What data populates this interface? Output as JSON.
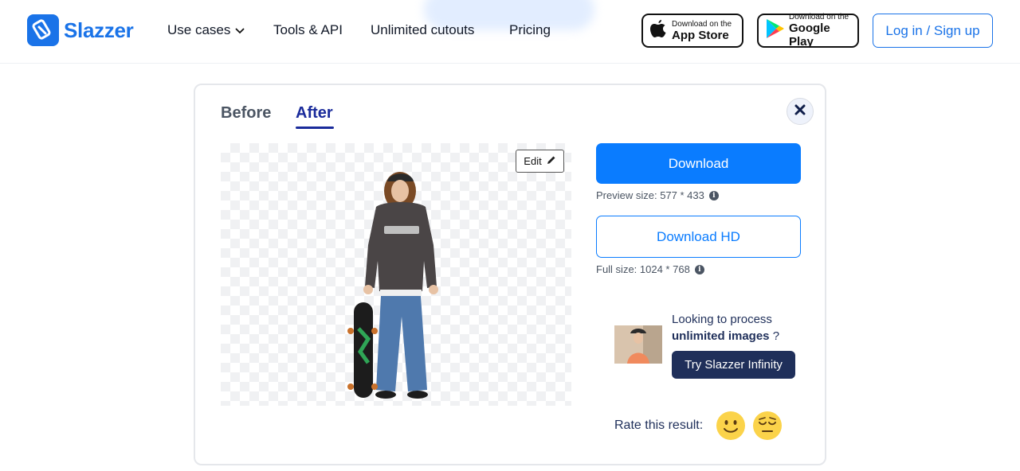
{
  "header": {
    "brand": "Slazzer",
    "nav": [
      {
        "label": "Use cases"
      },
      {
        "label": "Tools & API"
      },
      {
        "label": "Unlimited cutouts"
      },
      {
        "label": "Pricing"
      }
    ],
    "app_store": {
      "small": "Download on the",
      "big": "App Store",
      "icon": "apple-icon"
    },
    "google_play": {
      "small": "Download on the",
      "big": "Google Play",
      "icon": "google-play-icon"
    },
    "login_label": "Log in / Sign up",
    "accent": "#1a73e8"
  },
  "card": {
    "tabs": [
      {
        "label": "Before",
        "active": false
      },
      {
        "label": "After",
        "active": true
      }
    ],
    "edit_label": "Edit",
    "download_label": "Download",
    "preview_size": "Preview size: 577 * 433",
    "download_hd_label": "Download HD",
    "full_size": "Full size: 1024 * 768",
    "promo": {
      "line1": "Looking to process",
      "line2_bold": "unlimited images",
      "line2_tail": " ?",
      "button": "Try Slazzer Infinity"
    },
    "rate_label": "Rate this result:",
    "colors": {
      "primary": "#0a7cff",
      "navy": "#1f2f5a",
      "tab_active": "#1a2b9b"
    }
  }
}
